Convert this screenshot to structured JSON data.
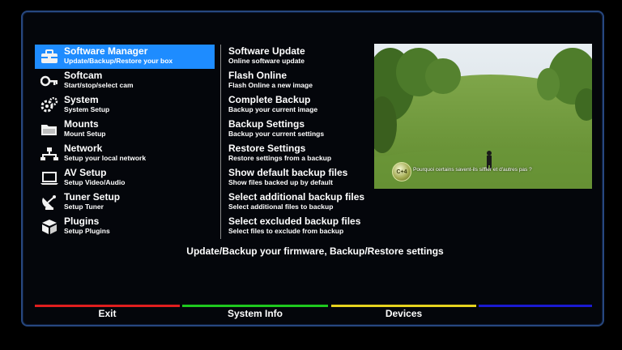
{
  "menu": {
    "items": [
      {
        "title": "Software Manager",
        "subtitle": "Update/Backup/Restore your box",
        "icon": "toolbox-icon",
        "selected": true
      },
      {
        "title": "Softcam",
        "subtitle": "Start/stop/select cam",
        "icon": "key-icon"
      },
      {
        "title": "System",
        "subtitle": "System Setup",
        "icon": "gears-icon"
      },
      {
        "title": "Mounts",
        "subtitle": "Mount Setup",
        "icon": "folder-icon"
      },
      {
        "title": "Network",
        "subtitle": "Setup your local network",
        "icon": "network-icon"
      },
      {
        "title": "AV Setup",
        "subtitle": "Setup Video/Audio",
        "icon": "laptop-icon"
      },
      {
        "title": "Tuner Setup",
        "subtitle": "Setup Tuner",
        "icon": "satellite-dish-icon"
      },
      {
        "title": "Plugins",
        "subtitle": "Setup Plugins",
        "icon": "puzzle-boxes-icon"
      }
    ]
  },
  "submenu": {
    "items": [
      {
        "title": "Software Update",
        "subtitle": "Online software update"
      },
      {
        "title": "Flash Online",
        "subtitle": "Flash Online a new image"
      },
      {
        "title": "Complete Backup",
        "subtitle": "Backup your current image"
      },
      {
        "title": "Backup Settings",
        "subtitle": "Backup your current settings"
      },
      {
        "title": "Restore Settings",
        "subtitle": "Restore settings from a backup"
      },
      {
        "title": "Show default backup files",
        "subtitle": "Show files backed up by default"
      },
      {
        "title": "Select additional backup files",
        "subtitle": "Select additional files to backup"
      },
      {
        "title": "Select excluded backup files",
        "subtitle": "Select files to exclude from backup"
      }
    ]
  },
  "preview": {
    "subtitle_text": "Pourquoi certains savent-ils siffler et d'autres pas ?",
    "logo_text": "C+4"
  },
  "description": "Update/Backup your firmware, Backup/Restore settings",
  "buttons": {
    "red": {
      "label": "Exit",
      "color": "#e01e1e"
    },
    "green": {
      "label": "System Info",
      "color": "#1ec81e"
    },
    "yellow": {
      "label": "Devices",
      "color": "#e6d21e"
    },
    "blue": {
      "label": "",
      "color": "#1a1ad0"
    }
  },
  "colors": {
    "selection": "#1e8cff",
    "frame_border": "#27477f"
  }
}
